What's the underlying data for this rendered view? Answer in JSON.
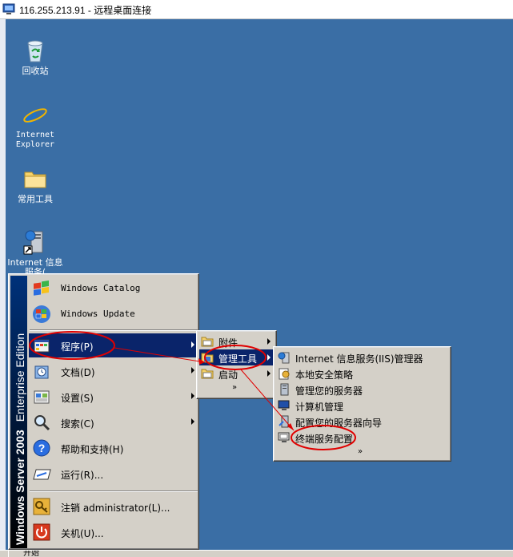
{
  "window": {
    "title": "116.255.213.91 - 远程桌面连接"
  },
  "desktop_icons": [
    {
      "label": "回收站",
      "icon": "recycle-bin-icon"
    },
    {
      "label": "Internet Explorer",
      "icon": "internet-explorer-icon"
    },
    {
      "label": "常用工具",
      "icon": "folder-icon"
    },
    {
      "label": "Internet 信息服务(",
      "icon": "iis-shortcut-icon"
    }
  ],
  "start_menu": {
    "banner": {
      "brand": "Windows Server 2003",
      "edition": "Enterprise Edition"
    },
    "top_items": [
      {
        "label": "Windows Catalog",
        "icon": "windows-catalog-icon"
      },
      {
        "label": "Windows Update",
        "icon": "windows-update-icon"
      }
    ],
    "items": [
      {
        "label": "程序(P)",
        "icon": "programs-icon",
        "submenu": true,
        "selected": true
      },
      {
        "label": "文档(D)",
        "icon": "documents-icon",
        "submenu": true
      },
      {
        "label": "设置(S)",
        "icon": "settings-icon",
        "submenu": true
      },
      {
        "label": "搜索(C)",
        "icon": "search-icon",
        "submenu": true
      },
      {
        "label": "帮助和支持(H)",
        "icon": "help-icon"
      },
      {
        "label": "运行(R)...",
        "icon": "run-icon"
      }
    ],
    "bottom_items": [
      {
        "label": "注销 administrator(L)...",
        "icon": "logoff-icon"
      },
      {
        "label": "关机(U)...",
        "icon": "shutdown-icon"
      }
    ]
  },
  "programs_submenu": {
    "items": [
      {
        "label": "附件",
        "icon": "folder-icon",
        "submenu": true
      },
      {
        "label": "管理工具",
        "icon": "folder-icon",
        "submenu": true,
        "selected": true
      },
      {
        "label": "启动",
        "icon": "folder-icon",
        "submenu": true
      }
    ],
    "more": "»"
  },
  "admin_tools_submenu": {
    "items": [
      {
        "label": "Internet 信息服务(IIS)管理器",
        "icon": "iis-manager-icon"
      },
      {
        "label": "本地安全策略",
        "icon": "security-policy-icon"
      },
      {
        "label": "管理您的服务器",
        "icon": "manage-server-icon"
      },
      {
        "label": "计算机管理",
        "icon": "computer-management-icon"
      },
      {
        "label": "配置您的服务器向导",
        "icon": "configure-server-icon"
      },
      {
        "label": "终端服务配置",
        "icon": "terminal-services-icon"
      }
    ],
    "more": "»"
  },
  "taskbar": {
    "start_label": "开始"
  },
  "colors": {
    "desktop": "#3a6ea5",
    "menu": "#d4d0c8",
    "highlight": "#0a246a",
    "annotation": "#e00000"
  }
}
